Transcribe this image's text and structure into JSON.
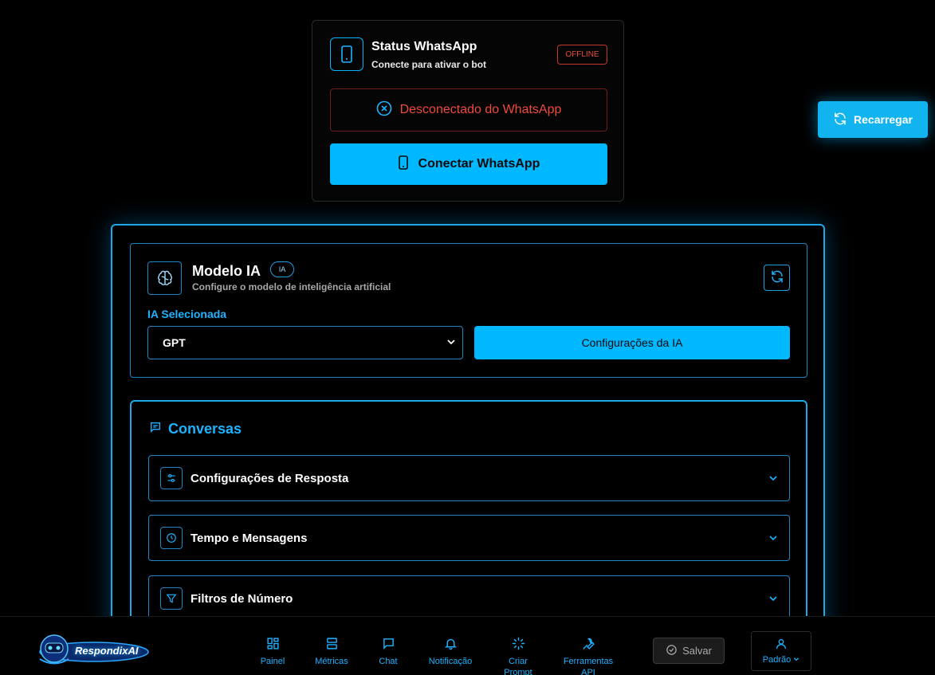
{
  "whatsapp": {
    "title": "Status WhatsApp",
    "subtitle": "Conecte para ativar o bot",
    "status_badge": "OFFLINE",
    "disconnected_text": "Desconectado do WhatsApp",
    "connect_label": "Conectar WhatsApp",
    "icons": [
      "phone-icon",
      "x-circle-icon"
    ]
  },
  "reload_label": "Recarregar",
  "model": {
    "title": "Modelo IA",
    "badge": "IA",
    "subtitle": "Configure o modelo de inteligência artificial",
    "select_label": "IA Selecionada",
    "selected_value": "GPT",
    "config_button": "Configurações da IA",
    "icons": [
      "brain-icon",
      "refresh-icon",
      "chevron-down-icon"
    ]
  },
  "conversations": {
    "title": "Conversas",
    "sections": [
      {
        "label": "Configurações de Resposta",
        "icon": "sliders-icon"
      },
      {
        "label": "Tempo e Mensagens",
        "icon": "clock-icon"
      },
      {
        "label": "Filtros de Número",
        "icon": "filter-icon"
      }
    ]
  },
  "bottom_nav": {
    "logo_text": "RespondixAI",
    "items": [
      {
        "label": "Painel",
        "icon": "grid-icon"
      },
      {
        "label": "Métricas",
        "icon": "layout-icon"
      },
      {
        "label": "Chat",
        "icon": "message-icon"
      },
      {
        "label": "Notificação",
        "icon": "bell-icon"
      },
      {
        "label": "Criar Prompt",
        "icon": "loader-icon"
      },
      {
        "label": "Ferramentas API",
        "icon": "wrench-icon"
      }
    ],
    "save_label": "Salvar",
    "profile_label": "Padrão"
  },
  "colors": {
    "accent": "#00b8ff",
    "danger": "#ef4a3c",
    "background": "#000000"
  }
}
